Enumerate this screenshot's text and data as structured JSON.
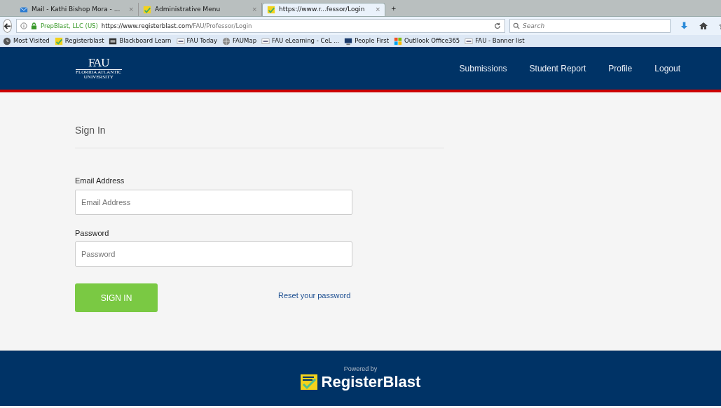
{
  "browser": {
    "tabs": [
      {
        "title": "Mail - Kathi Bishop Mora - ...",
        "close": "×",
        "selected": false
      },
      {
        "title": "Administrative Menu",
        "close": "×",
        "selected": false
      },
      {
        "title": "https://www.r...fessor/Login",
        "close": "×",
        "selected": true
      }
    ],
    "new_tab": "+",
    "identity": "PrepBlast, LLC (US)",
    "url_domain": "https://www.registerblast.com",
    "url_path": "/FAU/Professor/Login",
    "search": {
      "placeholder": "Search"
    },
    "bookmarks": [
      "Most Visited",
      "Registerblast",
      "Blackboard Learn",
      "FAU Today",
      "FAUMap",
      "FAU eLearning - CeL ...",
      "People First",
      "Outllook Office365",
      "FAU - Banner list"
    ]
  },
  "header": {
    "logo": {
      "mark": "FAU",
      "line1": "FLORIDA ATLANTIC",
      "line2": "UNIVERSITY"
    },
    "nav": [
      "Submissions",
      "Student Report",
      "Profile",
      "Logout"
    ]
  },
  "form": {
    "title": "Sign In",
    "fields": [
      {
        "label": "Email Address",
        "placeholder": "Email Address"
      },
      {
        "label": "Password",
        "placeholder": "Password"
      }
    ],
    "submit": "SIGN IN",
    "reset_link": "Reset your password"
  },
  "footer": {
    "powered_by": "Powered by",
    "brand": "RegisterBlast"
  }
}
